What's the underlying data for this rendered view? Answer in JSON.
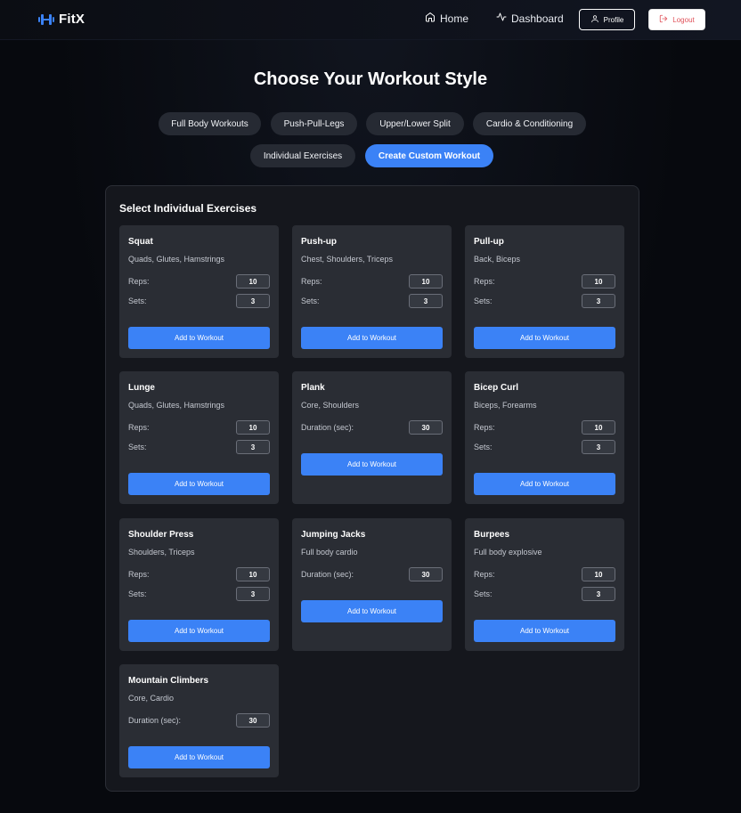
{
  "nav": {
    "brand": "FitX",
    "home": "Home",
    "dashboard": "Dashboard",
    "profile": "Profile",
    "logout": "Logout"
  },
  "page": {
    "title": "Choose Your Workout Style",
    "categories": [
      {
        "label": "Full Body Workouts",
        "active": false
      },
      {
        "label": "Push-Pull-Legs",
        "active": false
      },
      {
        "label": "Upper/Lower Split",
        "active": false
      },
      {
        "label": "Cardio & Conditioning",
        "active": false
      },
      {
        "label": "Individual Exercises",
        "active": false
      },
      {
        "label": "Create Custom Workout",
        "active": true
      }
    ]
  },
  "panel": {
    "title": "Select Individual Exercises",
    "labels": {
      "reps": "Reps:",
      "sets": "Sets:",
      "duration": "Duration (sec):",
      "add": "Add to Workout"
    },
    "exercises": [
      {
        "name": "Squat",
        "muscles": "Quads, Glutes, Hamstrings",
        "type": "reps",
        "reps": "10",
        "sets": "3"
      },
      {
        "name": "Push-up",
        "muscles": "Chest, Shoulders, Triceps",
        "type": "reps",
        "reps": "10",
        "sets": "3"
      },
      {
        "name": "Pull-up",
        "muscles": "Back, Biceps",
        "type": "reps",
        "reps": "10",
        "sets": "3"
      },
      {
        "name": "Lunge",
        "muscles": "Quads, Glutes, Hamstrings",
        "type": "reps",
        "reps": "10",
        "sets": "3"
      },
      {
        "name": "Plank",
        "muscles": "Core, Shoulders",
        "type": "duration",
        "duration": "30"
      },
      {
        "name": "Bicep Curl",
        "muscles": "Biceps, Forearms",
        "type": "reps",
        "reps": "10",
        "sets": "3"
      },
      {
        "name": "Shoulder Press",
        "muscles": "Shoulders, Triceps",
        "type": "reps",
        "reps": "10",
        "sets": "3"
      },
      {
        "name": "Jumping Jacks",
        "muscles": "Full body cardio",
        "type": "duration",
        "duration": "30"
      },
      {
        "name": "Burpees",
        "muscles": "Full body explosive",
        "type": "reps",
        "reps": "10",
        "sets": "3"
      },
      {
        "name": "Mountain Climbers",
        "muscles": "Core, Cardio",
        "type": "duration",
        "duration": "30"
      }
    ]
  },
  "colors": {
    "accent": "#3b82f6",
    "card": "#2a2d34",
    "logout_text": "#e0525a"
  },
  "icons": {
    "brand": "dumbbell-icon",
    "home": "home-icon",
    "dashboard": "activity-icon",
    "profile": "user-icon",
    "logout": "logout-icon"
  }
}
